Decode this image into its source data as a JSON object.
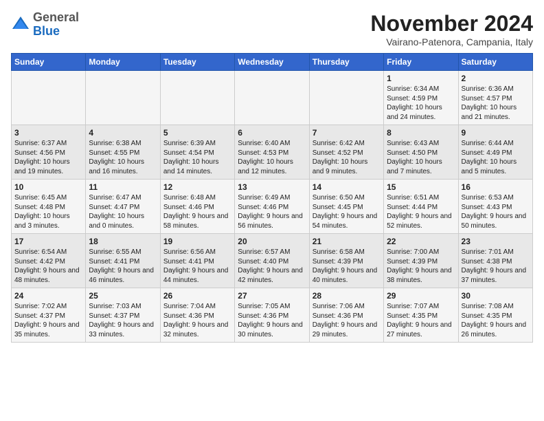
{
  "logo": {
    "general": "General",
    "blue": "Blue"
  },
  "calendar": {
    "title": "November 2024",
    "subtitle": "Vairano-Patenora, Campania, Italy"
  },
  "headers": [
    "Sunday",
    "Monday",
    "Tuesday",
    "Wednesday",
    "Thursday",
    "Friday",
    "Saturday"
  ],
  "weeks": [
    [
      {
        "day": "",
        "info": ""
      },
      {
        "day": "",
        "info": ""
      },
      {
        "day": "",
        "info": ""
      },
      {
        "day": "",
        "info": ""
      },
      {
        "day": "",
        "info": ""
      },
      {
        "day": "1",
        "info": "Sunrise: 6:34 AM\nSunset: 4:59 PM\nDaylight: 10 hours and 24 minutes."
      },
      {
        "day": "2",
        "info": "Sunrise: 6:36 AM\nSunset: 4:57 PM\nDaylight: 10 hours and 21 minutes."
      }
    ],
    [
      {
        "day": "3",
        "info": "Sunrise: 6:37 AM\nSunset: 4:56 PM\nDaylight: 10 hours and 19 minutes."
      },
      {
        "day": "4",
        "info": "Sunrise: 6:38 AM\nSunset: 4:55 PM\nDaylight: 10 hours and 16 minutes."
      },
      {
        "day": "5",
        "info": "Sunrise: 6:39 AM\nSunset: 4:54 PM\nDaylight: 10 hours and 14 minutes."
      },
      {
        "day": "6",
        "info": "Sunrise: 6:40 AM\nSunset: 4:53 PM\nDaylight: 10 hours and 12 minutes."
      },
      {
        "day": "7",
        "info": "Sunrise: 6:42 AM\nSunset: 4:52 PM\nDaylight: 10 hours and 9 minutes."
      },
      {
        "day": "8",
        "info": "Sunrise: 6:43 AM\nSunset: 4:50 PM\nDaylight: 10 hours and 7 minutes."
      },
      {
        "day": "9",
        "info": "Sunrise: 6:44 AM\nSunset: 4:49 PM\nDaylight: 10 hours and 5 minutes."
      }
    ],
    [
      {
        "day": "10",
        "info": "Sunrise: 6:45 AM\nSunset: 4:48 PM\nDaylight: 10 hours and 3 minutes."
      },
      {
        "day": "11",
        "info": "Sunrise: 6:47 AM\nSunset: 4:47 PM\nDaylight: 10 hours and 0 minutes."
      },
      {
        "day": "12",
        "info": "Sunrise: 6:48 AM\nSunset: 4:46 PM\nDaylight: 9 hours and 58 minutes."
      },
      {
        "day": "13",
        "info": "Sunrise: 6:49 AM\nSunset: 4:46 PM\nDaylight: 9 hours and 56 minutes."
      },
      {
        "day": "14",
        "info": "Sunrise: 6:50 AM\nSunset: 4:45 PM\nDaylight: 9 hours and 54 minutes."
      },
      {
        "day": "15",
        "info": "Sunrise: 6:51 AM\nSunset: 4:44 PM\nDaylight: 9 hours and 52 minutes."
      },
      {
        "day": "16",
        "info": "Sunrise: 6:53 AM\nSunset: 4:43 PM\nDaylight: 9 hours and 50 minutes."
      }
    ],
    [
      {
        "day": "17",
        "info": "Sunrise: 6:54 AM\nSunset: 4:42 PM\nDaylight: 9 hours and 48 minutes."
      },
      {
        "day": "18",
        "info": "Sunrise: 6:55 AM\nSunset: 4:41 PM\nDaylight: 9 hours and 46 minutes."
      },
      {
        "day": "19",
        "info": "Sunrise: 6:56 AM\nSunset: 4:41 PM\nDaylight: 9 hours and 44 minutes."
      },
      {
        "day": "20",
        "info": "Sunrise: 6:57 AM\nSunset: 4:40 PM\nDaylight: 9 hours and 42 minutes."
      },
      {
        "day": "21",
        "info": "Sunrise: 6:58 AM\nSunset: 4:39 PM\nDaylight: 9 hours and 40 minutes."
      },
      {
        "day": "22",
        "info": "Sunrise: 7:00 AM\nSunset: 4:39 PM\nDaylight: 9 hours and 38 minutes."
      },
      {
        "day": "23",
        "info": "Sunrise: 7:01 AM\nSunset: 4:38 PM\nDaylight: 9 hours and 37 minutes."
      }
    ],
    [
      {
        "day": "24",
        "info": "Sunrise: 7:02 AM\nSunset: 4:37 PM\nDaylight: 9 hours and 35 minutes."
      },
      {
        "day": "25",
        "info": "Sunrise: 7:03 AM\nSunset: 4:37 PM\nDaylight: 9 hours and 33 minutes."
      },
      {
        "day": "26",
        "info": "Sunrise: 7:04 AM\nSunset: 4:36 PM\nDaylight: 9 hours and 32 minutes."
      },
      {
        "day": "27",
        "info": "Sunrise: 7:05 AM\nSunset: 4:36 PM\nDaylight: 9 hours and 30 minutes."
      },
      {
        "day": "28",
        "info": "Sunrise: 7:06 AM\nSunset: 4:36 PM\nDaylight: 9 hours and 29 minutes."
      },
      {
        "day": "29",
        "info": "Sunrise: 7:07 AM\nSunset: 4:35 PM\nDaylight: 9 hours and 27 minutes."
      },
      {
        "day": "30",
        "info": "Sunrise: 7:08 AM\nSunset: 4:35 PM\nDaylight: 9 hours and 26 minutes."
      }
    ]
  ]
}
